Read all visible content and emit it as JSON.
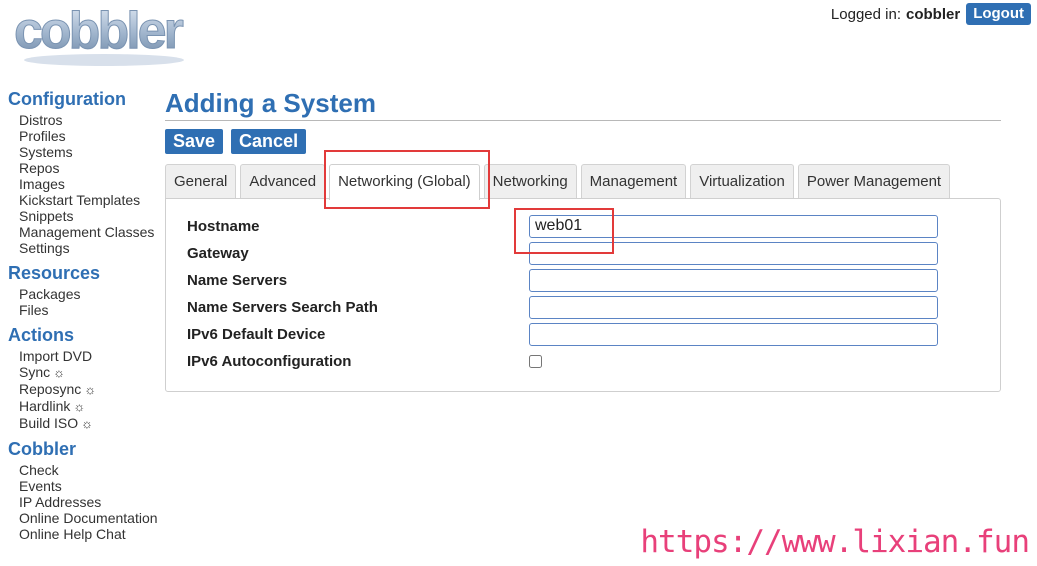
{
  "brand": {
    "logo_text": "cobbler"
  },
  "header": {
    "logged_in_label": "Logged in:",
    "username": "cobbler",
    "logout_label": "Logout"
  },
  "sidebar": {
    "sections": [
      {
        "title": "Configuration",
        "items": [
          "Distros",
          "Profiles",
          "Systems",
          "Repos",
          "Images",
          "Kickstart Templates",
          "Snippets",
          "Management Classes",
          "Settings"
        ]
      },
      {
        "title": "Resources",
        "items": [
          "Packages",
          "Files"
        ]
      },
      {
        "title": "Actions",
        "items": [
          "Import DVD",
          "Sync",
          "Reposync",
          "Hardlink",
          "Build ISO"
        ],
        "sync_icon_items": [
          1,
          2,
          3,
          4
        ]
      },
      {
        "title": "Cobbler",
        "items": [
          "Check",
          "Events",
          "IP Addresses",
          "Online Documentation",
          "Online Help Chat"
        ]
      }
    ],
    "sync_icon": "sun-icon"
  },
  "main": {
    "title": "Adding a System",
    "save_label": "Save",
    "cancel_label": "Cancel",
    "tabs": [
      "General",
      "Advanced",
      "Networking (Global)",
      "Networking",
      "Management",
      "Virtualization",
      "Power Management"
    ],
    "active_tab": 2,
    "fields": [
      {
        "label": "Hostname",
        "value": "web01",
        "type": "text"
      },
      {
        "label": "Gateway",
        "value": "",
        "type": "text"
      },
      {
        "label": "Name Servers",
        "value": "",
        "type": "text"
      },
      {
        "label": "Name Servers Search Path",
        "value": "",
        "type": "text"
      },
      {
        "label": "IPv6 Default Device",
        "value": "",
        "type": "text"
      },
      {
        "label": "IPv6 Autoconfiguration",
        "checked": false,
        "type": "checkbox"
      }
    ]
  },
  "watermark": "https://www.lixian.fun",
  "colors": {
    "accent": "#2f6fb3",
    "highlight": "#e23a3a",
    "watermark": "#e8407a"
  }
}
